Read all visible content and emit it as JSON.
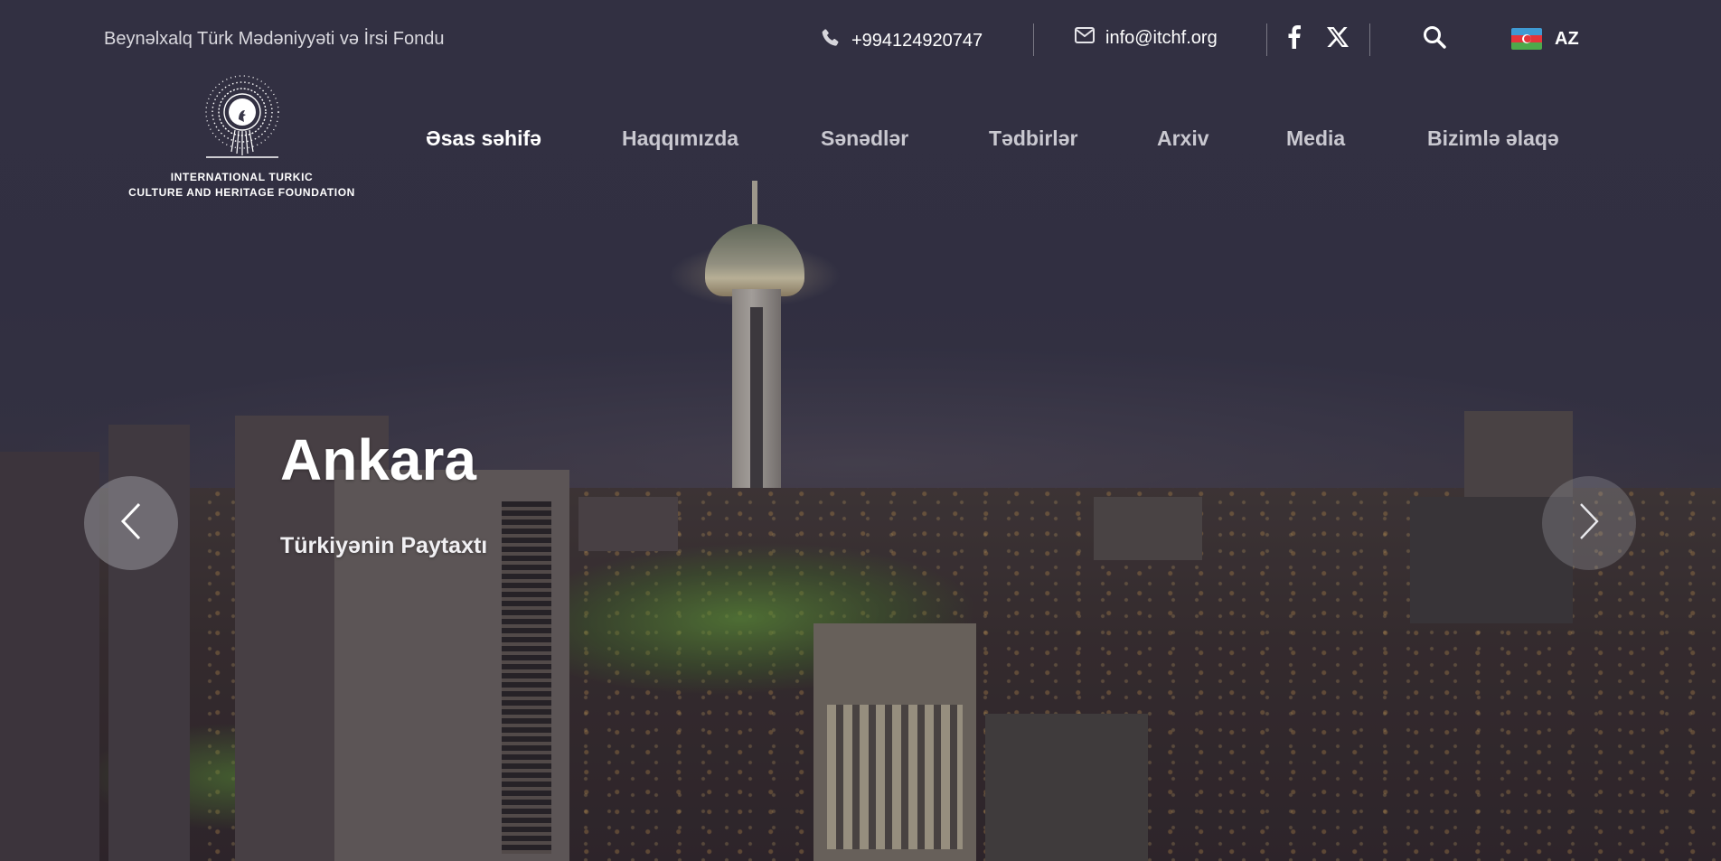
{
  "topbar": {
    "org_name": "Beynəlxalq Türk Mədəniyyəti və İrsi Fondu",
    "phone": "+994124920747",
    "email": "info@itchf.org",
    "language": "AZ",
    "icons": {
      "phone": "phone-icon",
      "email": "mail-icon",
      "facebook": "facebook-icon",
      "x": "x-twitter-icon",
      "search": "search-icon",
      "flag": "azerbaijan-flag-icon"
    }
  },
  "logo": {
    "line1": "INTERNATIONAL TURKIC",
    "line2": "CULTURE AND HERITAGE FOUNDATION"
  },
  "nav": {
    "items": [
      {
        "label": "Əsas səhifə",
        "active": true
      },
      {
        "label": "Haqqımızda",
        "active": false
      },
      {
        "label": "Sənədlər",
        "active": false
      },
      {
        "label": "Tədbirlər",
        "active": false
      },
      {
        "label": "Arxiv",
        "active": false
      },
      {
        "label": "Media",
        "active": false
      },
      {
        "label": "Bizimlə əlaqə",
        "active": false
      }
    ]
  },
  "slide": {
    "title": "Ankara",
    "subtitle": "Türkiyənin Paytaxtı"
  },
  "carousel": {
    "prev_icon": "chevron-left-icon",
    "next_icon": "chevron-right-icon"
  },
  "colors": {
    "overlay": "#2e2d3e",
    "text": "#ffffff",
    "nav_inactive": "#c9c8d0"
  }
}
